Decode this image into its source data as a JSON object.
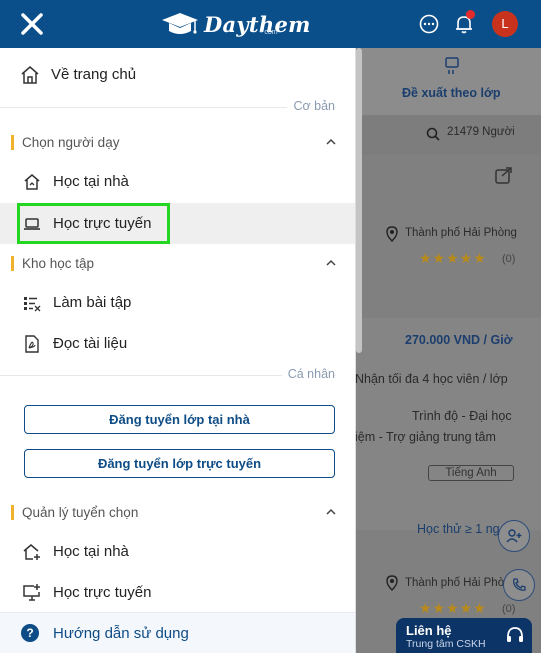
{
  "header": {
    "logo_text": "Daythem",
    "logo_sub": "• com",
    "avatar_initial": "L",
    "brand_color": "#0b4f8a"
  },
  "background": {
    "tab_label": "Đề xuất theo lớp",
    "search_count": "21479 Người",
    "card1": {
      "location": "Thành phố Hải Phòng",
      "rating": "(0)"
    },
    "card2": {
      "price": "270.000 VND / Giờ",
      "line1": "Nhận tối đa 4 học viên / lớp",
      "line2": "Trình độ - Đại học",
      "line3": "iệm - Trợ giảng trung tâm",
      "subject_tag": "Tiếng Anh",
      "lesson_text": "Học thử ≥ 1 ng"
    },
    "card3": {
      "location": "Thành phố Hải Phòng",
      "rating": "(0)"
    },
    "contact": {
      "title": "Liên hệ",
      "subtitle": "Trung tâm CSKH"
    }
  },
  "drawer": {
    "home_label": "Về trang chủ",
    "section_basic": "Cơ bản",
    "group_choose_tutor": {
      "title": "Chọn người dạy",
      "items": [
        {
          "label": "Học tại nhà",
          "icon": "home-study-icon"
        },
        {
          "label": "Học trực tuyến",
          "icon": "laptop-icon"
        }
      ]
    },
    "group_library": {
      "title": "Kho học tập",
      "items": [
        {
          "label": "Làm bài tập",
          "icon": "exercise-list-icon"
        },
        {
          "label": "Đọc tài liệu",
          "icon": "pdf-document-icon"
        }
      ]
    },
    "section_personal": "Cá nhân",
    "cta_home": "Đăng tuyển lớp tại nhà",
    "cta_online": "Đăng tuyển lớp trực tuyến",
    "group_manage": {
      "title": "Quản lý tuyển chọn",
      "items": [
        {
          "label": "Học tại nhà",
          "icon": "home-add-icon"
        },
        {
          "label": "Học trực tuyến",
          "icon": "monitor-add-icon"
        }
      ]
    },
    "guide_label": "Hướng dẫn sử dụng",
    "accent_color": "#f2b12c",
    "highlight_color": "#22d622"
  }
}
